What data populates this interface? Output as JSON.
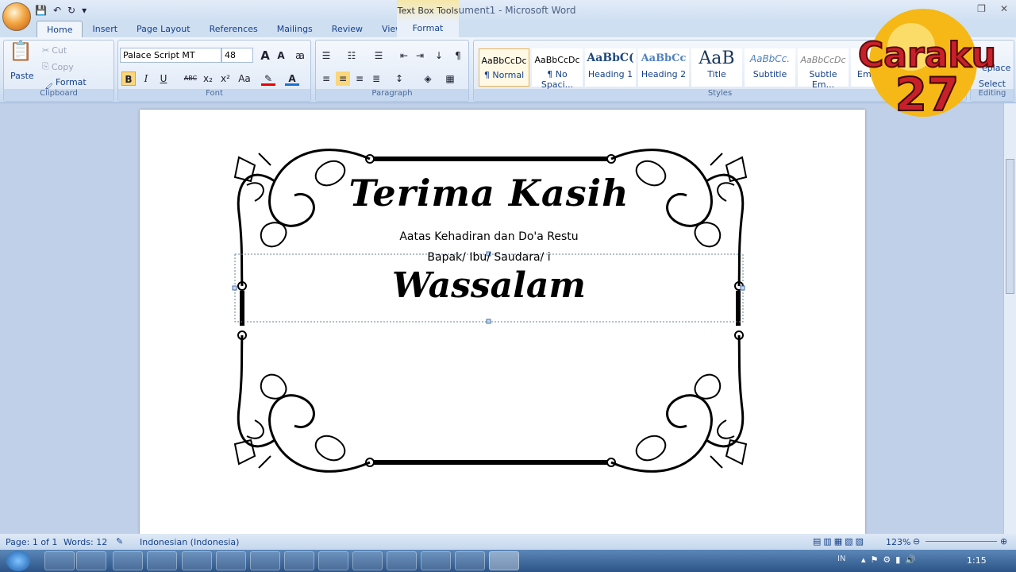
{
  "window": {
    "title": "Document1 - Microsoft Word",
    "context_tab": "Text Box Tools"
  },
  "tabs": [
    "Home",
    "Insert",
    "Page Layout",
    "References",
    "Mailings",
    "Review",
    "View",
    "Format"
  ],
  "clipboard": {
    "paste": "Paste",
    "cut": "Cut",
    "copy": "Copy",
    "format_painter": "Format Painter",
    "label": "Clipboard"
  },
  "font": {
    "name": "Palace Script MT",
    "size": "48",
    "label": "Font",
    "bold": "B",
    "italic": "I",
    "underline": "U",
    "strike": "ABC"
  },
  "paragraph": {
    "label": "Paragraph"
  },
  "styles": {
    "label": "Styles",
    "items": [
      {
        "preview": "AaBbCcDc",
        "name": "¶ Normal"
      },
      {
        "preview": "AaBbCcDc",
        "name": "¶ No Spaci..."
      },
      {
        "preview": "AaBbC(",
        "name": "Heading 1"
      },
      {
        "preview": "AaBbCc",
        "name": "Heading 2"
      },
      {
        "preview": "AaB",
        "name": "Title"
      },
      {
        "preview": "AaBbCc.",
        "name": "Subtitle"
      },
      {
        "preview": "AaBbCcDc",
        "name": "Subtle Em..."
      },
      {
        "preview": "",
        "name": "Emp"
      }
    ]
  },
  "editing": {
    "replace": "eplace",
    "select": "Select",
    "label": "Editing"
  },
  "logo": {
    "text1": "Caraku",
    "text2": "27"
  },
  "document": {
    "heading": "Terima Kasih",
    "line1": "Aatas Kehadiran dan Do'a  Restu",
    "line2": "Bapak/ Ibu/ Saudara/ i",
    "closing": "Wassalam"
  },
  "status": {
    "page": "Page: 1 of 1",
    "words": "Words: 12",
    "language": "Indonesian (Indonesia)",
    "zoom": "123%"
  },
  "taskbar": {
    "lang": "IN",
    "time": "1:15"
  },
  "colors": {
    "ribbon": "#dde8f6",
    "accent": "#15428b",
    "taskbar": "#2d5487"
  }
}
